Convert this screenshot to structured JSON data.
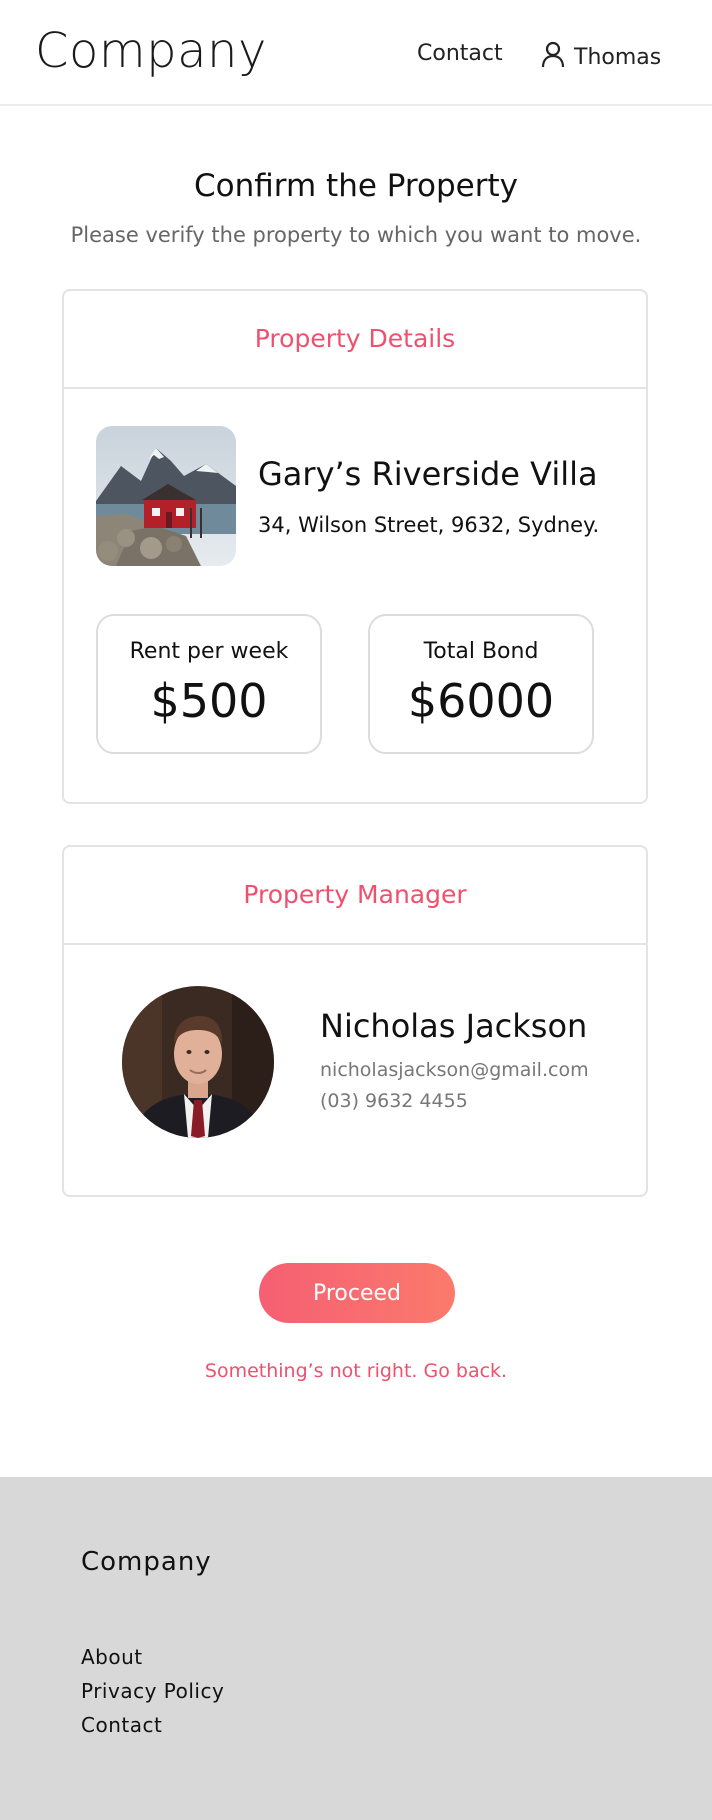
{
  "header": {
    "logo": "Company",
    "nav_contact": "Contact",
    "user_name": "Thomas",
    "user_icon": "user-icon"
  },
  "page": {
    "title": "Confirm the Property",
    "subtitle": "Please verify the property to which you want to move."
  },
  "property": {
    "section_title": "Property Details",
    "name": "Gary’s Riverside Villa",
    "address": "34, Wilson Street, 9632, Sydney.",
    "rent_label": "Rent per week",
    "rent_value": "$500",
    "bond_label": "Total Bond",
    "bond_value": "$6000"
  },
  "manager": {
    "section_title": "Property Manager",
    "name": "Nicholas Jackson",
    "email": "nicholasjackson@gmail.com",
    "phone": "(03) 9632 4455"
  },
  "actions": {
    "proceed_label": "Proceed",
    "go_back_label": "Something’s not right. Go back."
  },
  "footer": {
    "brand": "Company",
    "links": [
      "About",
      "Privacy Policy",
      "Contact"
    ]
  },
  "colors": {
    "accent": "#f0506e",
    "button_gradient_start": "#f55f73",
    "button_gradient_end": "#fb7a6c",
    "footer_bg": "#d8d8d8"
  }
}
